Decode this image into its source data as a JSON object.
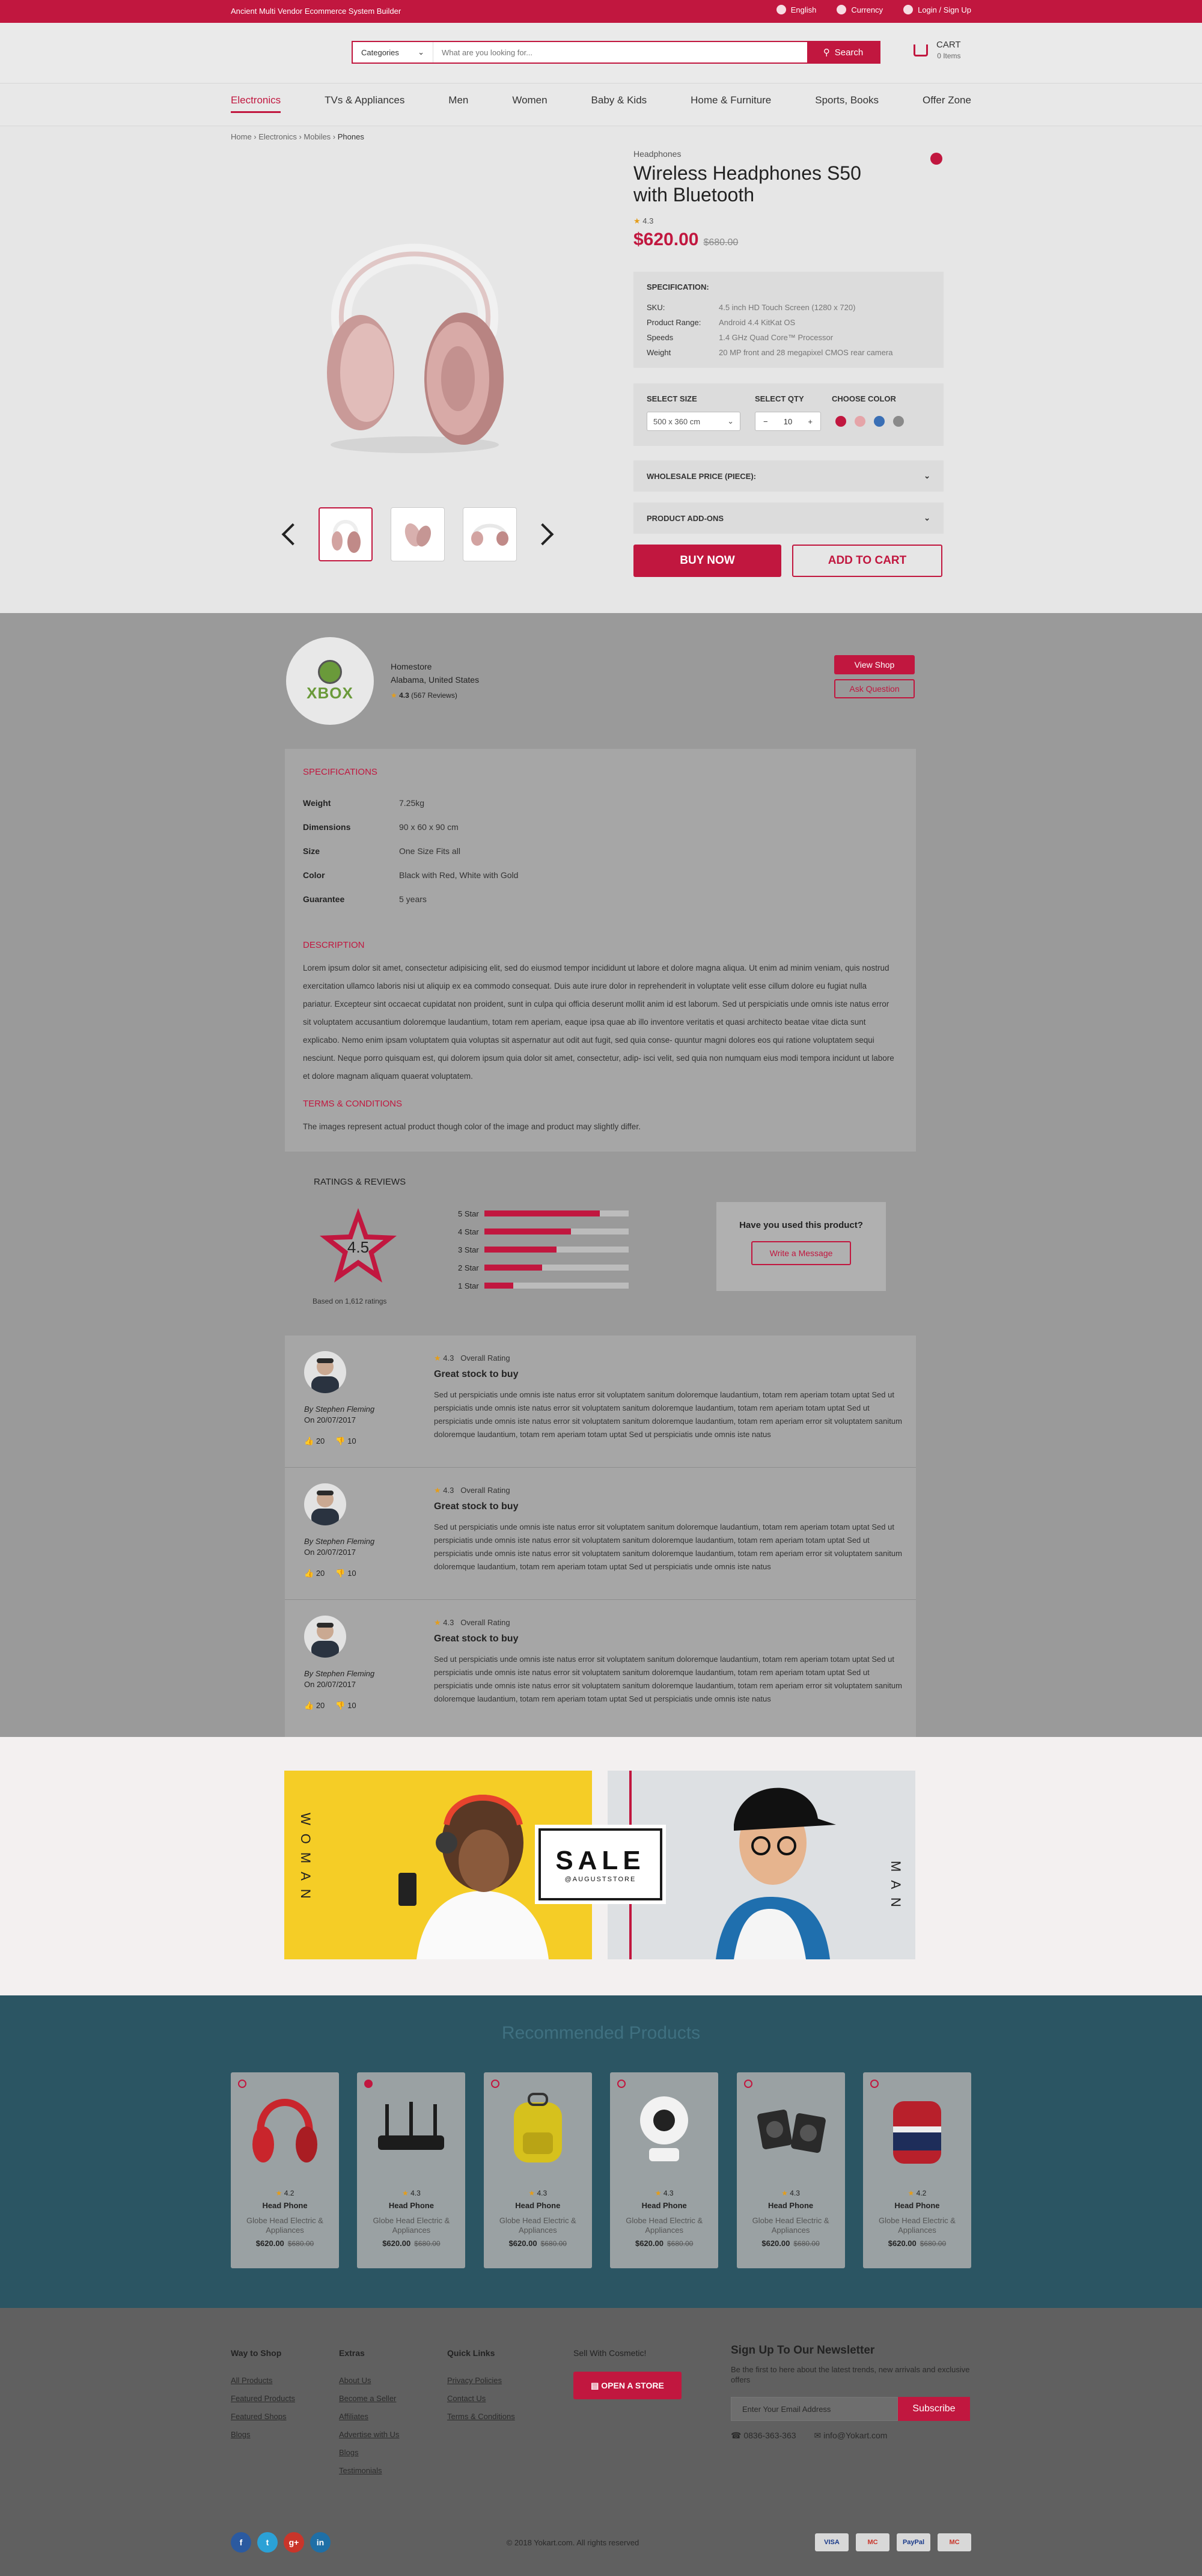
{
  "topbar": {
    "tagline": "Ancient Multi Vendor Ecommerce System Builder",
    "language": "English",
    "currency": "Currency",
    "login": "Login / Sign Up"
  },
  "header": {
    "categories_label": "Categories",
    "search_placeholder": "What are you looking for...",
    "search_button": "Search",
    "cart_label": "CART",
    "cart_items": "0 Items"
  },
  "nav": [
    "Electronics",
    "TVs & Appliances",
    "Men",
    "Women",
    "Baby & Kids",
    "Home & Furniture",
    "Sports, Books",
    "Offer Zone"
  ],
  "breadcrumb": [
    "Home",
    "Electronics",
    "Mobiles",
    "Phones"
  ],
  "product": {
    "category": "Headphones",
    "title": "Wireless Headphones S50 with Bluetooth",
    "rating": "4.3",
    "price": "$620.00",
    "old_price": "$680.00",
    "spec_heading": "SPECIFICATION:",
    "specs": [
      {
        "k": "SKU:",
        "v": "4.5 inch HD Touch Screen (1280 x 720)"
      },
      {
        "k": "Product Range:",
        "v": "Android 4.4 KitKat OS"
      },
      {
        "k": "Speeds",
        "v": "1.4 GHz Quad Core™ Processor"
      },
      {
        "k": "Weight",
        "v": "20 MP front and 28 megapixel CMOS rear camera"
      }
    ],
    "select_size_label": "SELECT SIZE",
    "select_qty_label": "SELECT QTY",
    "choose_color_label": "CHOOSE COLOR",
    "size_value": "500 x 360 cm",
    "qty_value": "10",
    "colors": [
      "#c1173f",
      "#e5a4a8",
      "#3a6fb5",
      "#8a8a8a"
    ],
    "wholesale_label": "WHOLESALE PRICE (PIECE):",
    "addons_label": "PRODUCT ADD-ONS",
    "buy_now": "BUY NOW",
    "add_to_cart": "ADD TO CART"
  },
  "seller": {
    "logo_text": "XBOX",
    "name": "Homestore",
    "location": "Alabama, United States",
    "rating": "4.3",
    "reviews": "(567 Reviews)",
    "view_shop": "View Shop",
    "ask_question": "Ask Question"
  },
  "details": {
    "spec_heading": "SPECIFICATIONS",
    "specs": [
      {
        "k": "Weight",
        "v": "7.25kg"
      },
      {
        "k": "Dimensions",
        "v": "90 x 60 x 90 cm"
      },
      {
        "k": "Size",
        "v": "One Size Fits all"
      },
      {
        "k": "Color",
        "v": "Black with Red, White with Gold"
      },
      {
        "k": "Guarantee",
        "v": "5 years"
      }
    ],
    "desc_heading": "DESCRIPTION",
    "description": "Lorem ipsum dolor sit amet, consectetur adipisicing elit, sed do eiusmod tempor incididunt ut labore et dolore magna aliqua. Ut enim ad minim veniam, quis nostrud exercitation ullamco laboris nisi ut aliquip ex ea commodo consequat. Duis aute irure dolor in reprehenderit in voluptate velit esse cillum dolore eu fugiat nulla pariatur. Excepteur sint occaecat cupidatat non proident, sunt in culpa qui officia deserunt mollit anim id est laborum. Sed ut perspiciatis unde omnis iste natus error sit voluptatem accusantium doloremque laudantium, totam rem aperiam, eaque ipsa quae ab illo inventore veritatis et quasi architecto beatae vitae dicta sunt explicabo. Nemo enim ipsam voluptatem quia voluptas sit aspernatur aut odit aut fugit, sed quia conse- quuntur magni dolores eos qui ratione voluptatem sequi nesciunt. Neque porro quisquam est, qui dolorem ipsum quia dolor sit amet, consectetur, adip- isci velit, sed quia non numquam eius modi tempora incidunt ut labore et dolore magnam aliquam quaerat voluptatem.",
    "terms_heading": "TERMS & CONDITIONS",
    "terms": "The images represent actual product though color of the image and product may slightly differ."
  },
  "ratings": {
    "heading": "RATINGS & REVIEWS",
    "score": "4.5",
    "based_on": "Based on 1,612 ratings",
    "bars": [
      {
        "label": "5 Star",
        "value": 0.8
      },
      {
        "label": "4 Star",
        "value": 0.6
      },
      {
        "label": "3 Star",
        "value": 0.5
      },
      {
        "label": "2 Star",
        "value": 0.4
      },
      {
        "label": "1 Star",
        "value": 0.2
      }
    ],
    "ask_title": "Have you used this product?",
    "ask_button": "Write a Message"
  },
  "reviews": [
    {
      "rating": "4.3",
      "overall": "Overall Rating",
      "title": "Great stock to buy",
      "author": "By Stephen Fleming",
      "date": "On 20/07/2017",
      "likes": "20",
      "dislikes": "10",
      "body": "Sed ut perspiciatis unde omnis iste natus error sit voluptatem sanitum doloremque laudantium, totam rem aperiam totam uptat Sed ut perspiciatis unde omnis iste natus error sit voluptatem sanitum doloremque laudantium, totam rem aperiam totam uptat Sed ut perspiciatis unde omnis iste natus error sit voluptatem sanitum doloremque laudantium, totam rem aperiam error sit voluptatem sanitum doloremque laudantium, totam rem aperiam totam uptat Sed ut perspiciatis unde omnis iste natus"
    },
    {
      "rating": "4.3",
      "overall": "Overall Rating",
      "title": "Great stock to buy",
      "author": "By Stephen Fleming",
      "date": "On 20/07/2017",
      "likes": "20",
      "dislikes": "10",
      "body": "Sed ut perspiciatis unde omnis iste natus error sit voluptatem sanitum doloremque laudantium, totam rem aperiam totam uptat Sed ut perspiciatis unde omnis iste natus error sit voluptatem sanitum doloremque laudantium, totam rem aperiam totam uptat Sed ut perspiciatis unde omnis iste natus error sit voluptatem sanitum doloremque laudantium, totam rem aperiam error sit voluptatem sanitum doloremque laudantium, totam rem aperiam totam uptat Sed ut perspiciatis unde omnis iste natus"
    },
    {
      "rating": "4.3",
      "overall": "Overall Rating",
      "title": "Great stock to buy",
      "author": "By Stephen Fleming",
      "date": "On 20/07/2017",
      "likes": "20",
      "dislikes": "10",
      "body": "Sed ut perspiciatis unde omnis iste natus error sit voluptatem sanitum doloremque laudantium, totam rem aperiam totam uptat Sed ut perspiciatis unde omnis iste natus error sit voluptatem sanitum doloremque laudantium, totam rem aperiam totam uptat Sed ut perspiciatis unde omnis iste natus error sit voluptatem sanitum doloremque laudantium, totam rem aperiam error sit voluptatem sanitum doloremque laudantium, totam rem aperiam totam uptat Sed ut perspiciatis unde omnis iste natus"
    }
  ],
  "promo": {
    "left_label": "WOMAN",
    "sale": "SALE",
    "sale_sub": "@AUGUSTSTORE",
    "right_label": "MAN"
  },
  "recommended": {
    "heading": "Recommended Products",
    "items": [
      {
        "icon": "headphones-icon",
        "color": "#c9252c",
        "rating": "4.2",
        "name": "Head Phone",
        "store": "Globe Head Electric & Appliances",
        "price": "$620.00",
        "old": "$680.00"
      },
      {
        "icon": "router-icon",
        "color": "#1c1c1c",
        "rating": "4.3",
        "name": "Head Phone",
        "store": "Globe Head Electric & Appliances",
        "price": "$620.00",
        "old": "$680.00"
      },
      {
        "icon": "backpack-icon",
        "color": "#d6c11d",
        "rating": "4.3",
        "name": "Head Phone",
        "store": "Globe Head Electric & Appliances",
        "price": "$620.00",
        "old": "$680.00"
      },
      {
        "icon": "camera-icon",
        "color": "#f2f2f2",
        "rating": "4.3",
        "name": "Head Phone",
        "store": "Globe Head Electric & Appliances",
        "price": "$620.00",
        "old": "$680.00"
      },
      {
        "icon": "speakers-icon",
        "color": "#2a2a2a",
        "rating": "4.3",
        "name": "Head Phone",
        "store": "Globe Head Electric & Appliances",
        "price": "$620.00",
        "old": "$680.00"
      },
      {
        "icon": "bag-icon",
        "color": "#b8202b",
        "rating": "4.2",
        "name": "Head Phone",
        "store": "Globe Head Electric & Appliances",
        "price": "$620.00",
        "old": "$680.00"
      }
    ]
  },
  "footer": {
    "col1": {
      "title": "Way to Shop",
      "links": [
        "All Products",
        "Featured Products",
        "Featured Shops",
        "Blogs"
      ]
    },
    "col2": {
      "title": "Extras",
      "links": [
        "About Us",
        "Become a Seller",
        "Affiliates",
        "Advertise with Us",
        "Blogs",
        "Testimonials"
      ]
    },
    "col3": {
      "title": "Quick Links",
      "links": [
        "Privacy Policies",
        "Contact Us",
        "Terms & Conditions"
      ]
    },
    "col4": {
      "title": "Sell With Cosmetic!",
      "button": "OPEN A STORE"
    },
    "newsletter": {
      "title": "Sign Up To Our Newsletter",
      "text": "Be the first to here about the latest trends, new arrivals and exclusive offers",
      "placeholder": "Enter Your Email Address",
      "button": "Subscribe",
      "phone": "0836-363-363",
      "email": "info@Yokart.com"
    },
    "copyright": "© 2018 Yokart.com. All rights reserved",
    "payments": [
      "VISA",
      "MC",
      "PayPal",
      "MC"
    ]
  }
}
